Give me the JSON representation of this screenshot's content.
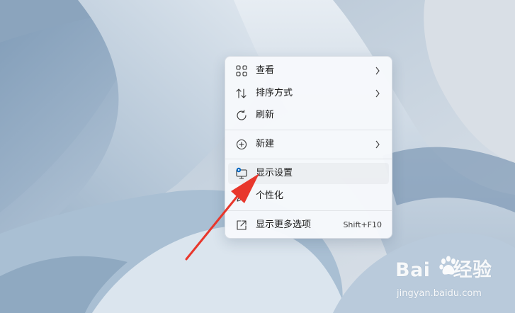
{
  "menu": {
    "items": [
      {
        "label": "查看",
        "icon": "grid-view-icon",
        "has_submenu": true
      },
      {
        "label": "排序方式",
        "icon": "sort-icon",
        "has_submenu": true
      },
      {
        "label": "刷新",
        "icon": "refresh-icon",
        "has_submenu": false
      },
      {
        "label": "新建",
        "icon": "new-plus-icon",
        "has_submenu": true
      },
      {
        "label": "显示设置",
        "icon": "display-settings-icon",
        "has_submenu": false
      },
      {
        "label": "个性化",
        "icon": "personalize-brush-icon",
        "has_submenu": false
      },
      {
        "label": "显示更多选项",
        "icon": "show-more-options-icon",
        "has_submenu": false,
        "shortcut": "Shift+F10"
      }
    ]
  },
  "watermark": {
    "brand": "Bai",
    "brand_suffix": "经验",
    "url": "jingyan.baidu.com"
  },
  "colors": {
    "arrow": "#e8372c",
    "accent": "#0067c0"
  }
}
